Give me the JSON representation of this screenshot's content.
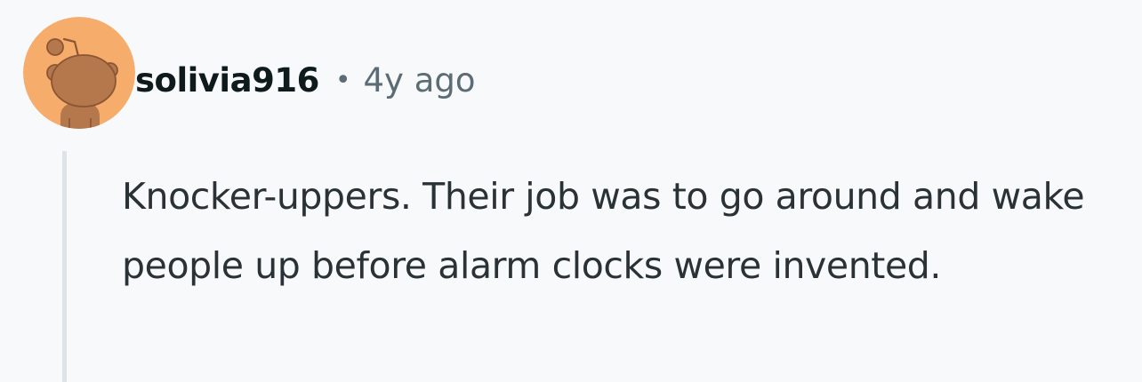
{
  "comment": {
    "avatar_icon": "reddit-snoo-avatar-icon",
    "avatar_color": "#f6ac6a",
    "username": "solivia916",
    "separator": "•",
    "timestamp": "4y ago",
    "body": "Knocker-uppers. Their job was to go around and wake people up before alarm clocks were invented."
  }
}
